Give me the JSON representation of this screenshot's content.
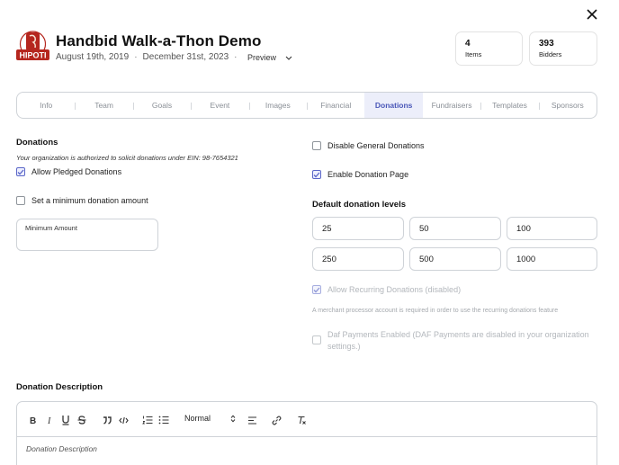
{
  "header": {
    "title": "Handbid Walk-a-Thon Demo",
    "start_date": "August 19th, 2019",
    "end_date": "December 31st, 2023",
    "date_separator": "·",
    "preview_label": "Preview",
    "logo_text": "HIPOTI"
  },
  "stats": [
    {
      "value": "4",
      "label": "Items"
    },
    {
      "value": "393",
      "label": "Bidders"
    }
  ],
  "tabs": [
    "Info",
    "Team",
    "Goals",
    "Event",
    "Images",
    "Financial",
    "Donations",
    "Fundraisers",
    "Templates",
    "Sponsors"
  ],
  "active_tab": "Donations",
  "donations": {
    "section_title": "Donations",
    "ein_note": "Your organization is authorized to solicit donations under EIN: 98-7654321",
    "allow_pledged": {
      "label": "Allow Pledged Donations",
      "checked": true
    },
    "set_minimum": {
      "label": "Set a minimum donation amount",
      "checked": false
    },
    "minimum_amount": {
      "label": "Minimum Amount",
      "value": ""
    }
  },
  "right_panel": {
    "disable_general": {
      "label": "Disable General Donations",
      "checked": false
    },
    "enable_page": {
      "label": "Enable Donation Page",
      "checked": true
    },
    "levels_title": "Default donation levels",
    "levels": [
      "25",
      "50",
      "100",
      "250",
      "500",
      "1000"
    ],
    "recurring": {
      "label": "Allow Recurring Donations (disabled)",
      "checked": true,
      "disabled": true
    },
    "merchant_note": "A merchant processor account is required in order to use the recurring donations feature",
    "daf": {
      "label": "Daf Payments Enabled (DAF Payments are disabled in your organization settings.)",
      "checked": false,
      "disabled": true
    }
  },
  "description": {
    "section_title": "Donation Description",
    "format_value": "Normal",
    "placeholder": "Donation Description"
  },
  "colors": {
    "accent": "#4a57b8",
    "active_tab_bg": "#eceefa",
    "logo_red": "#b5261e"
  }
}
